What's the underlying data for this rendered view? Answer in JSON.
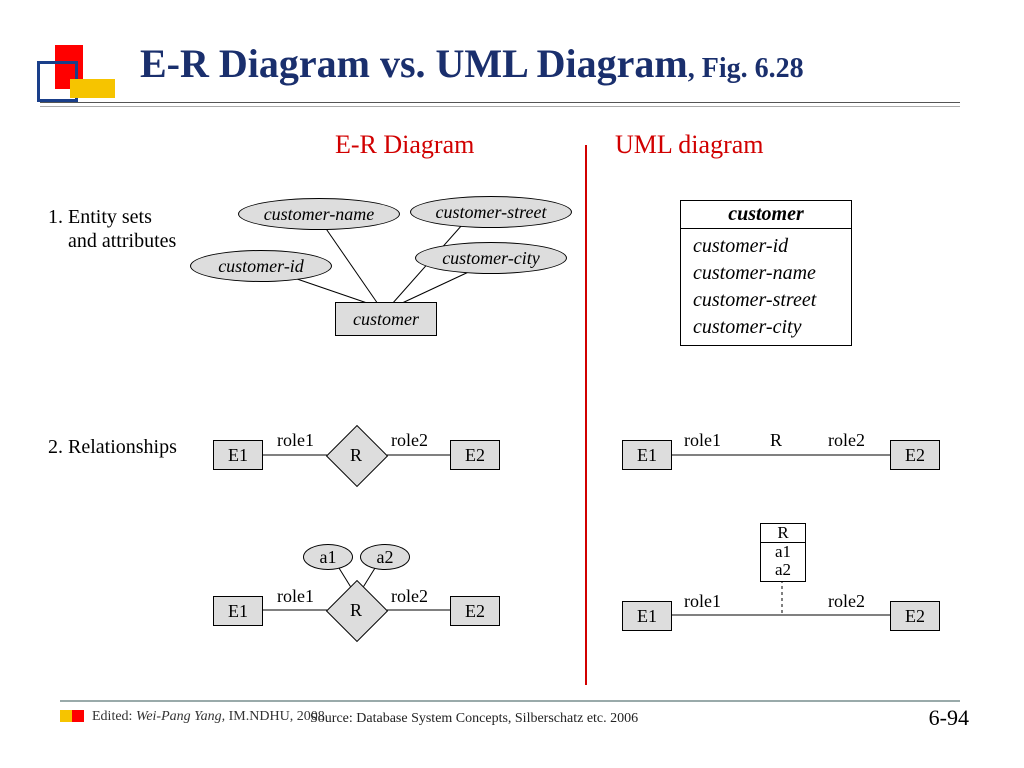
{
  "title_main": "E-R Diagram vs. UML Diagram",
  "title_fig": ", Fig. 6.28",
  "columns": {
    "left": "E-R Diagram",
    "right": "UML diagram"
  },
  "rows": {
    "r1_line1": "1. Entity sets",
    "r1_line2": "    and attributes",
    "r2": "2. Relationships"
  },
  "er_row1": {
    "entity": "customer",
    "attr1": "customer-id",
    "attr2": "customer-name",
    "attr3": "customer-street",
    "attr4": "customer-city"
  },
  "uml_row1": {
    "class": "customer",
    "a1": "customer-id",
    "a2": "customer-name",
    "a3": "customer-street",
    "a4": "customer-city"
  },
  "rel_row2": {
    "E1": "E1",
    "E2": "E2",
    "R": "R",
    "role1": "role1",
    "role2": "role2",
    "a1": "a1",
    "a2": "a2"
  },
  "footer": {
    "edited_label": "Edited: ",
    "edited_by": "Wei-Pang Yang, ",
    "edited_inst": "IM.NDHU, 2008",
    "source": "Source: Database System Concepts, Silberschatz etc. 2006",
    "chapter": "6",
    "page": "94"
  }
}
